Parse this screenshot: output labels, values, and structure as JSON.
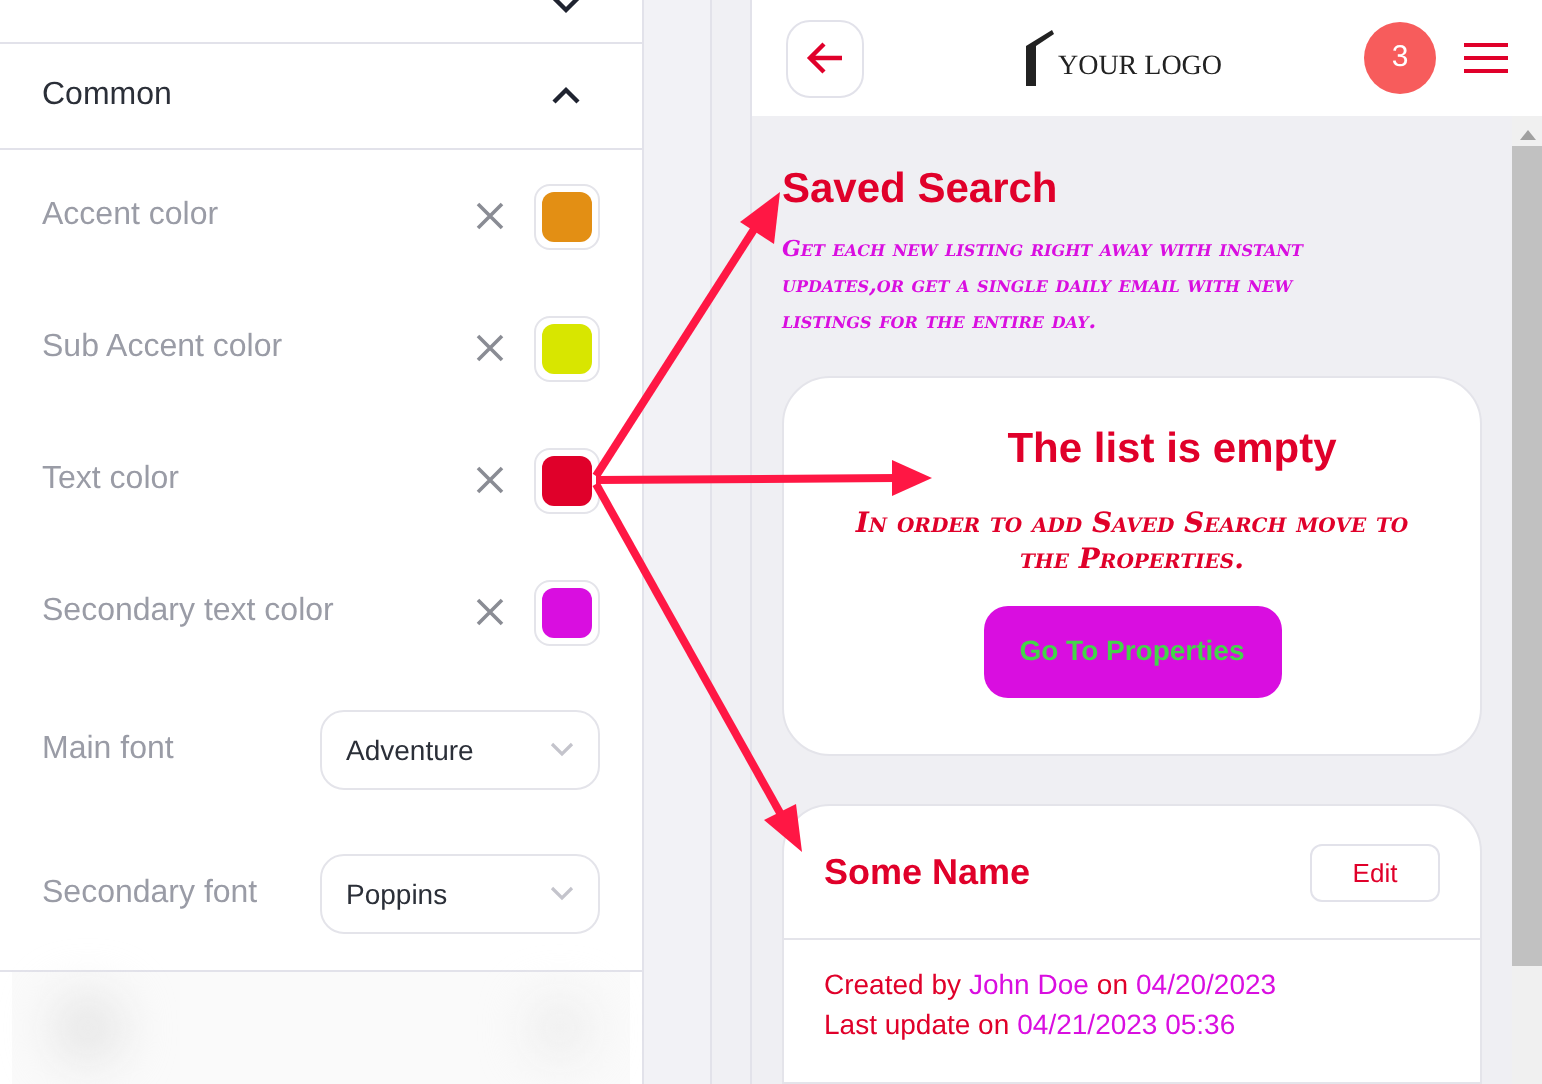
{
  "settings": {
    "collapsed_section": {
      "expanded": false
    },
    "common": {
      "title": "Common",
      "expanded": true
    },
    "colors": [
      {
        "label": "Accent color",
        "color": "#e38f14"
      },
      {
        "label": "Sub Accent color",
        "color": "#d8e600"
      },
      {
        "label": "Text color",
        "color": "#e0002a"
      },
      {
        "label": "Secondary text color",
        "color": "#d90ee0"
      }
    ],
    "fonts": [
      {
        "label": "Main font",
        "value": "Adventure"
      },
      {
        "label": "Secondary font",
        "value": "Poppins"
      }
    ]
  },
  "phone": {
    "logo": "YOUR LOGO",
    "badge": "3",
    "title": "Saved Search",
    "description": "Get each new listing right away with instant updates,or get a single daily email with new listings for the entire day.",
    "empty_card": {
      "title": "The list is empty",
      "message": "In order to add Saved Search move to the Properties.",
      "button": "Go To Properties"
    },
    "saved_item": {
      "name": "Some Name",
      "edit": "Edit",
      "created_label": "Created by",
      "author": "John Doe",
      "on_label": "on",
      "created_date": "04/20/2023",
      "updated_label": "Last update on",
      "updated_date": "04/21/2023 05:36"
    }
  }
}
